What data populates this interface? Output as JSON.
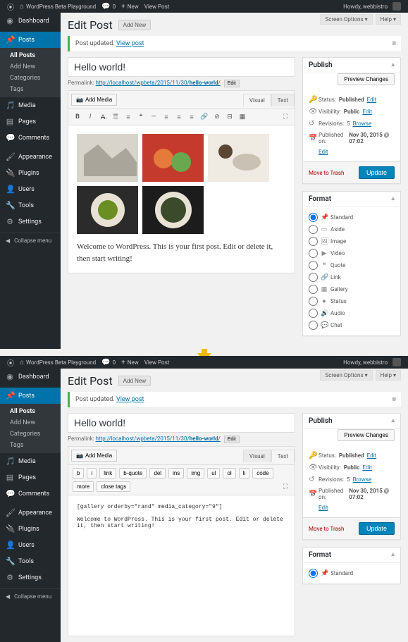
{
  "adminbar": {
    "site": "WordPress Beta Playground",
    "comments": "0",
    "new": "New",
    "view": "View Post",
    "howdy": "Howdy, webbistro"
  },
  "screen_options": "Screen Options",
  "help": "Help",
  "menu": {
    "dashboard": "Dashboard",
    "posts": "Posts",
    "media": "Media",
    "pages": "Pages",
    "comments": "Comments",
    "appearance": "Appearance",
    "plugins": "Plugins",
    "users": "Users",
    "tools": "Tools",
    "settings": "Settings",
    "collapse": "Collapse menu",
    "posts_sub": {
      "all": "All Posts",
      "add": "Add New",
      "cats": "Categories",
      "tags": "Tags"
    }
  },
  "page": {
    "title": "Edit Post",
    "add_new": "Add New"
  },
  "notice": {
    "msg": "Post updated.",
    "link": "View post"
  },
  "title_value": "Hello world!",
  "permalink": {
    "label": "Permalink:",
    "base": "http://localhost/wpbeta/2015/11/30/",
    "slug": "hello-world",
    "edit": "Edit"
  },
  "add_media": "Add Media",
  "tabs": {
    "visual": "Visual",
    "text": "Text"
  },
  "qt": [
    "b",
    "i",
    "link",
    "b-quote",
    "del",
    "ins",
    "img",
    "ul",
    "ol",
    "li",
    "code",
    "more",
    "close tags"
  ],
  "post_body": "Welcome to WordPress. This is your first post. Edit or delete it, then start writing!",
  "text_body": "[gallery orderby=\"rand\" media_category=\"9\"]\n\nWelcome to WordPress. This is your first post. Edit or delete it, then start writing!",
  "publish": {
    "title": "Publish",
    "preview": "Preview Changes",
    "status_l": "Status:",
    "status_v": "Published",
    "edit": "Edit",
    "vis_l": "Visibility:",
    "vis_v": "Public",
    "rev_l": "Revisions:",
    "rev_v": "5",
    "browse": "Browse",
    "pub_l": "Published on:",
    "pub_v": "Nov 30, 2015 @ 07:02",
    "trash": "Move to Trash",
    "update": "Update"
  },
  "format": {
    "title": "Format",
    "options": [
      "Standard",
      "Aside",
      "Image",
      "Video",
      "Quote",
      "Link",
      "Gallery",
      "Status",
      "Audio",
      "Chat"
    ]
  },
  "chart_data": null
}
